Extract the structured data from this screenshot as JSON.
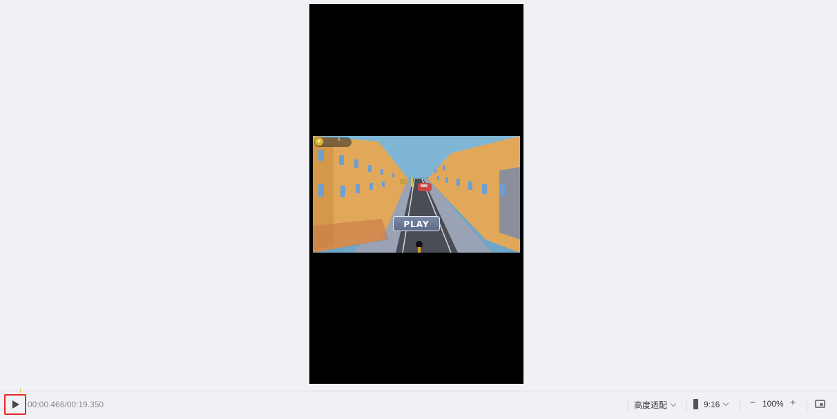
{
  "preview": {
    "game": {
      "play_label": "PLAY",
      "coin_count": "0"
    }
  },
  "toolbar": {
    "timecode": "00:00.466/00:19.350",
    "fit_mode_label": "高度适配",
    "aspect_ratio_label": "9:16",
    "zoom_level": "100%",
    "zoom_out_symbol": "−",
    "zoom_in_symbol": "+"
  },
  "colors": {
    "background": "#f0f1f5",
    "highlight_border": "#e02a22",
    "stage": "#000000"
  },
  "icons": {
    "play": "play-icon",
    "coin": "coin-icon",
    "aspect_ratio": "portrait-ratio-icon",
    "fit_screen": "fit-screen-icon"
  }
}
